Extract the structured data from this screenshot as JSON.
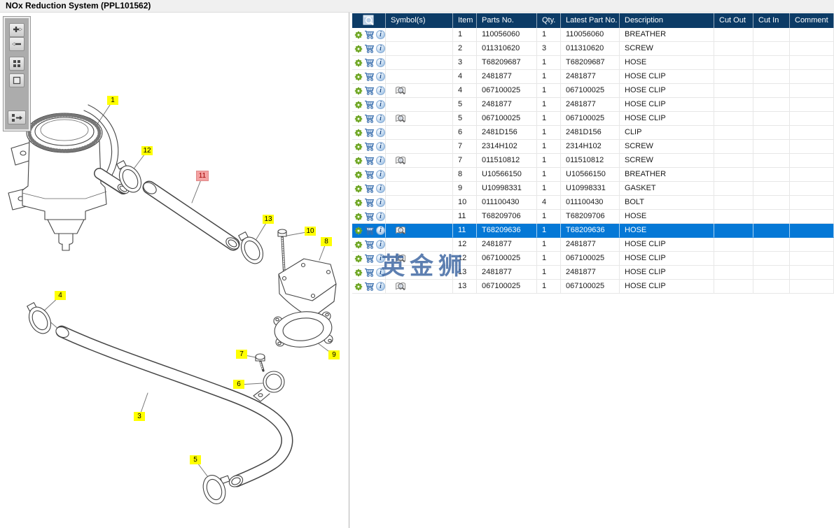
{
  "window": {
    "title": "NOx Reduction System (PPL101562)"
  },
  "toolbar": {
    "buttons": [
      {
        "id": "zoom-in",
        "icon": "plus-arrow-icon"
      },
      {
        "id": "zoom-out",
        "icon": "minus-arrow-icon"
      },
      {
        "id": "tile-view",
        "icon": "grid-squares-icon"
      },
      {
        "id": "single-view",
        "icon": "square-outline-icon"
      },
      {
        "id": "toggle-parts-list",
        "icon": "list-arrow-icon"
      }
    ]
  },
  "diagram": {
    "labels": [
      {
        "text": "1",
        "highlighted": false
      },
      {
        "text": "12",
        "highlighted": false
      },
      {
        "text": "11",
        "highlighted": true
      },
      {
        "text": "13",
        "highlighted": false
      },
      {
        "text": "10",
        "highlighted": false
      },
      {
        "text": "8",
        "highlighted": false
      },
      {
        "text": "4",
        "highlighted": false
      },
      {
        "text": "7",
        "highlighted": false
      },
      {
        "text": "6",
        "highlighted": false
      },
      {
        "text": "3",
        "highlighted": false
      },
      {
        "text": "9",
        "highlighted": false
      },
      {
        "text": "5",
        "highlighted": false
      }
    ]
  },
  "table": {
    "columns": [
      "",
      "Symbol(s)",
      "Item",
      "Parts No.",
      "Qty.",
      "Latest Part No.",
      "Description",
      "Cut Out",
      "Cut In",
      "Comment"
    ],
    "row_action_icons": [
      "gear-icon",
      "cart-icon",
      "info-icon"
    ],
    "rows": [
      {
        "item": "1",
        "parts_no": "110056060",
        "qty": "1",
        "latest_part_no": "110056060",
        "description": "BREATHER",
        "cut_out": "",
        "cut_in": "",
        "comment": "",
        "has_symbol": false,
        "selected": false
      },
      {
        "item": "2",
        "parts_no": "011310620",
        "qty": "3",
        "latest_part_no": "011310620",
        "description": "SCREW",
        "cut_out": "",
        "cut_in": "",
        "comment": "",
        "has_symbol": false,
        "selected": false
      },
      {
        "item": "3",
        "parts_no": "T68209687",
        "qty": "1",
        "latest_part_no": "T68209687",
        "description": "HOSE",
        "cut_out": "",
        "cut_in": "",
        "comment": "",
        "has_symbol": false,
        "selected": false
      },
      {
        "item": "4",
        "parts_no": "2481877",
        "qty": "1",
        "latest_part_no": "2481877",
        "description": "HOSE CLIP",
        "cut_out": "",
        "cut_in": "",
        "comment": "",
        "has_symbol": false,
        "selected": false
      },
      {
        "item": "4",
        "parts_no": "067100025",
        "qty": "1",
        "latest_part_no": "067100025",
        "description": "HOSE CLIP",
        "cut_out": "",
        "cut_in": "",
        "comment": "",
        "has_symbol": true,
        "selected": false
      },
      {
        "item": "5",
        "parts_no": "2481877",
        "qty": "1",
        "latest_part_no": "2481877",
        "description": "HOSE CLIP",
        "cut_out": "",
        "cut_in": "",
        "comment": "",
        "has_symbol": false,
        "selected": false
      },
      {
        "item": "5",
        "parts_no": "067100025",
        "qty": "1",
        "latest_part_no": "067100025",
        "description": "HOSE CLIP",
        "cut_out": "",
        "cut_in": "",
        "comment": "",
        "has_symbol": true,
        "selected": false
      },
      {
        "item": "6",
        "parts_no": "2481D156",
        "qty": "1",
        "latest_part_no": "2481D156",
        "description": "CLIP",
        "cut_out": "",
        "cut_in": "",
        "comment": "",
        "has_symbol": false,
        "selected": false
      },
      {
        "item": "7",
        "parts_no": "2314H102",
        "qty": "1",
        "latest_part_no": "2314H102",
        "description": "SCREW",
        "cut_out": "",
        "cut_in": "",
        "comment": "",
        "has_symbol": false,
        "selected": false
      },
      {
        "item": "7",
        "parts_no": "011510812",
        "qty": "1",
        "latest_part_no": "011510812",
        "description": "SCREW",
        "cut_out": "",
        "cut_in": "",
        "comment": "",
        "has_symbol": true,
        "selected": false
      },
      {
        "item": "8",
        "parts_no": "U10566150",
        "qty": "1",
        "latest_part_no": "U10566150",
        "description": "BREATHER",
        "cut_out": "",
        "cut_in": "",
        "comment": "",
        "has_symbol": false,
        "selected": false
      },
      {
        "item": "9",
        "parts_no": "U10998331",
        "qty": "1",
        "latest_part_no": "U10998331",
        "description": "GASKET",
        "cut_out": "",
        "cut_in": "",
        "comment": "",
        "has_symbol": false,
        "selected": false
      },
      {
        "item": "10",
        "parts_no": "011100430",
        "qty": "4",
        "latest_part_no": "011100430",
        "description": "BOLT",
        "cut_out": "",
        "cut_in": "",
        "comment": "",
        "has_symbol": false,
        "selected": false
      },
      {
        "item": "11",
        "parts_no": "T68209706",
        "qty": "1",
        "latest_part_no": "T68209706",
        "description": "HOSE",
        "cut_out": "",
        "cut_in": "",
        "comment": "",
        "has_symbol": false,
        "selected": false
      },
      {
        "item": "11",
        "parts_no": "T68209636",
        "qty": "1",
        "latest_part_no": "T68209636",
        "description": "HOSE",
        "cut_out": "",
        "cut_in": "",
        "comment": "",
        "has_symbol": true,
        "selected": true
      },
      {
        "item": "12",
        "parts_no": "2481877",
        "qty": "1",
        "latest_part_no": "2481877",
        "description": "HOSE CLIP",
        "cut_out": "",
        "cut_in": "",
        "comment": "",
        "has_symbol": false,
        "selected": false
      },
      {
        "item": "12",
        "parts_no": "067100025",
        "qty": "1",
        "latest_part_no": "067100025",
        "description": "HOSE CLIP",
        "cut_out": "",
        "cut_in": "",
        "comment": "",
        "has_symbol": true,
        "selected": false
      },
      {
        "item": "13",
        "parts_no": "2481877",
        "qty": "1",
        "latest_part_no": "2481877",
        "description": "HOSE CLIP",
        "cut_out": "",
        "cut_in": "",
        "comment": "",
        "has_symbol": false,
        "selected": false
      },
      {
        "item": "13",
        "parts_no": "067100025",
        "qty": "1",
        "latest_part_no": "067100025",
        "description": "HOSE CLIP",
        "cut_out": "",
        "cut_in": "",
        "comment": "",
        "has_symbol": true,
        "selected": false
      }
    ]
  },
  "watermark": {
    "text": "英金狮"
  },
  "colors": {
    "header_bg": "#0c3b66",
    "selected_row": "#0578d6",
    "callout_yellow": "#ffff00",
    "callout_highlight_bg": "#f4a2a2",
    "callout_highlight_text": "#a00000",
    "gear_green": "#7ab32c",
    "cart_blue": "#3a6fae",
    "watermark_blue": "#3a64a0"
  }
}
